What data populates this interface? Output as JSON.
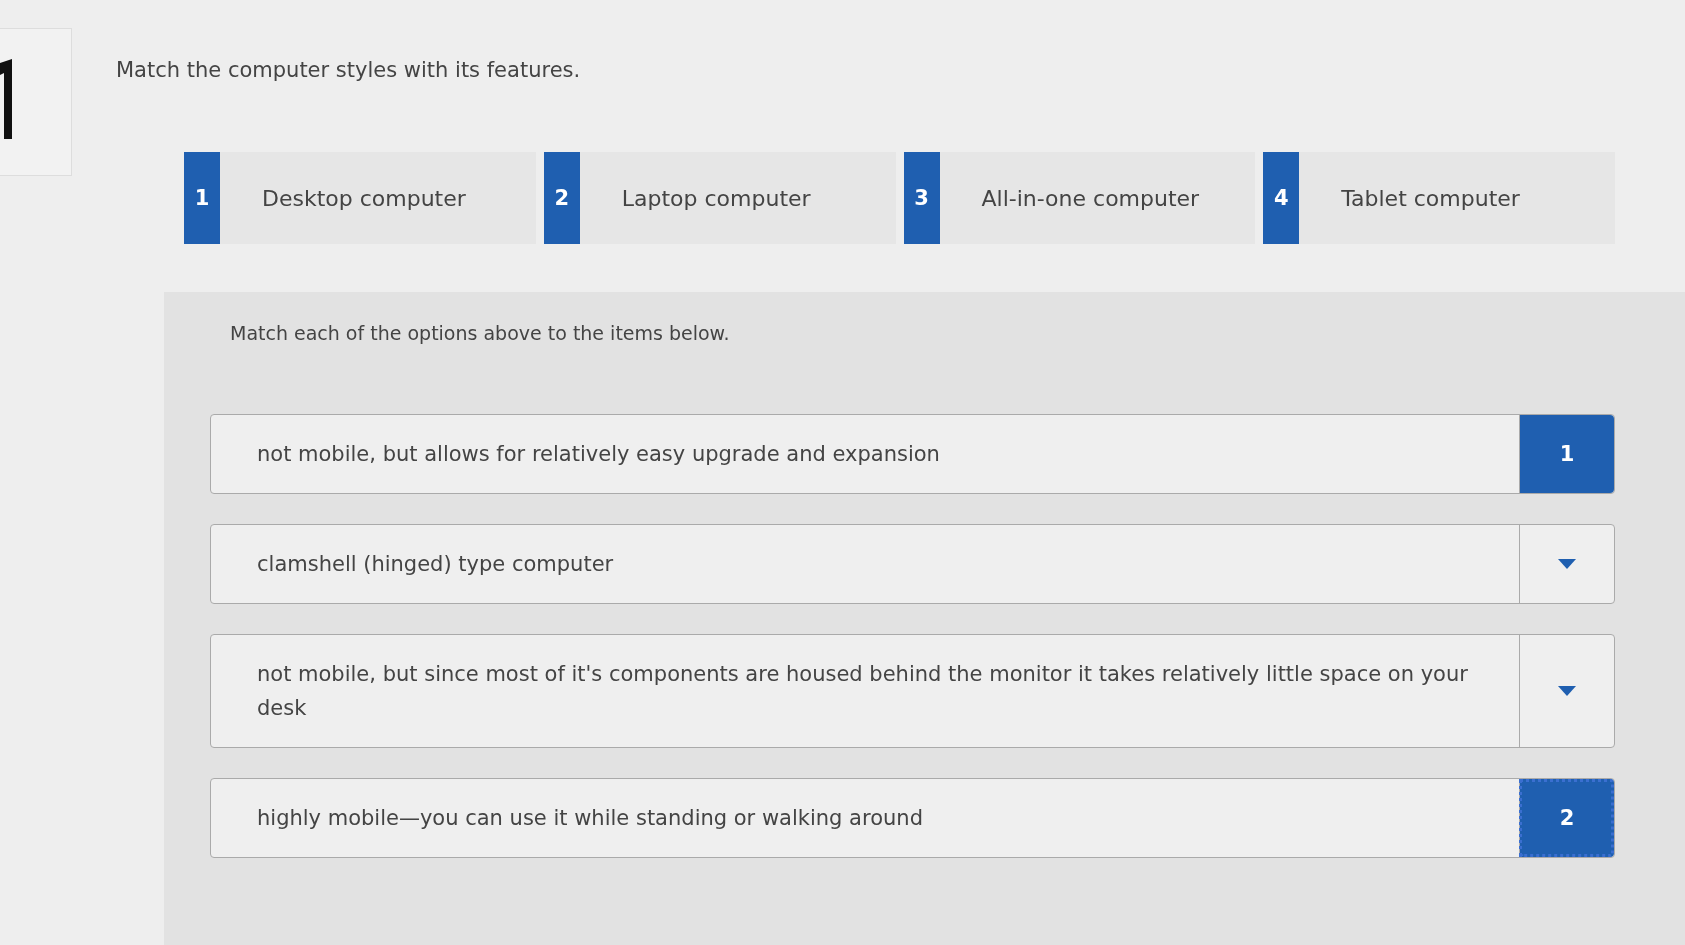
{
  "question": "Match the computer styles with its features.",
  "options": [
    {
      "number": "1",
      "label": "Desktop computer"
    },
    {
      "number": "2",
      "label": "Laptop computer"
    },
    {
      "number": "3",
      "label": "All-in-one computer"
    },
    {
      "number": "4",
      "label": "Tablet computer"
    }
  ],
  "instruction": "Match each of the options above to the items below.",
  "items": [
    {
      "text": "not mobile, but allows for relatively easy upgrade and expansion",
      "answer": "1",
      "focused": false
    },
    {
      "text": "clamshell (hinged) type computer",
      "focused": false
    },
    {
      "text": "not mobile, but since most of it's components are housed behind the monitor it takes relatively little space on your desk",
      "focused": false
    },
    {
      "text": "highly mobile—you can use it while standing or walking around",
      "answer": "2",
      "focused": true
    }
  ]
}
